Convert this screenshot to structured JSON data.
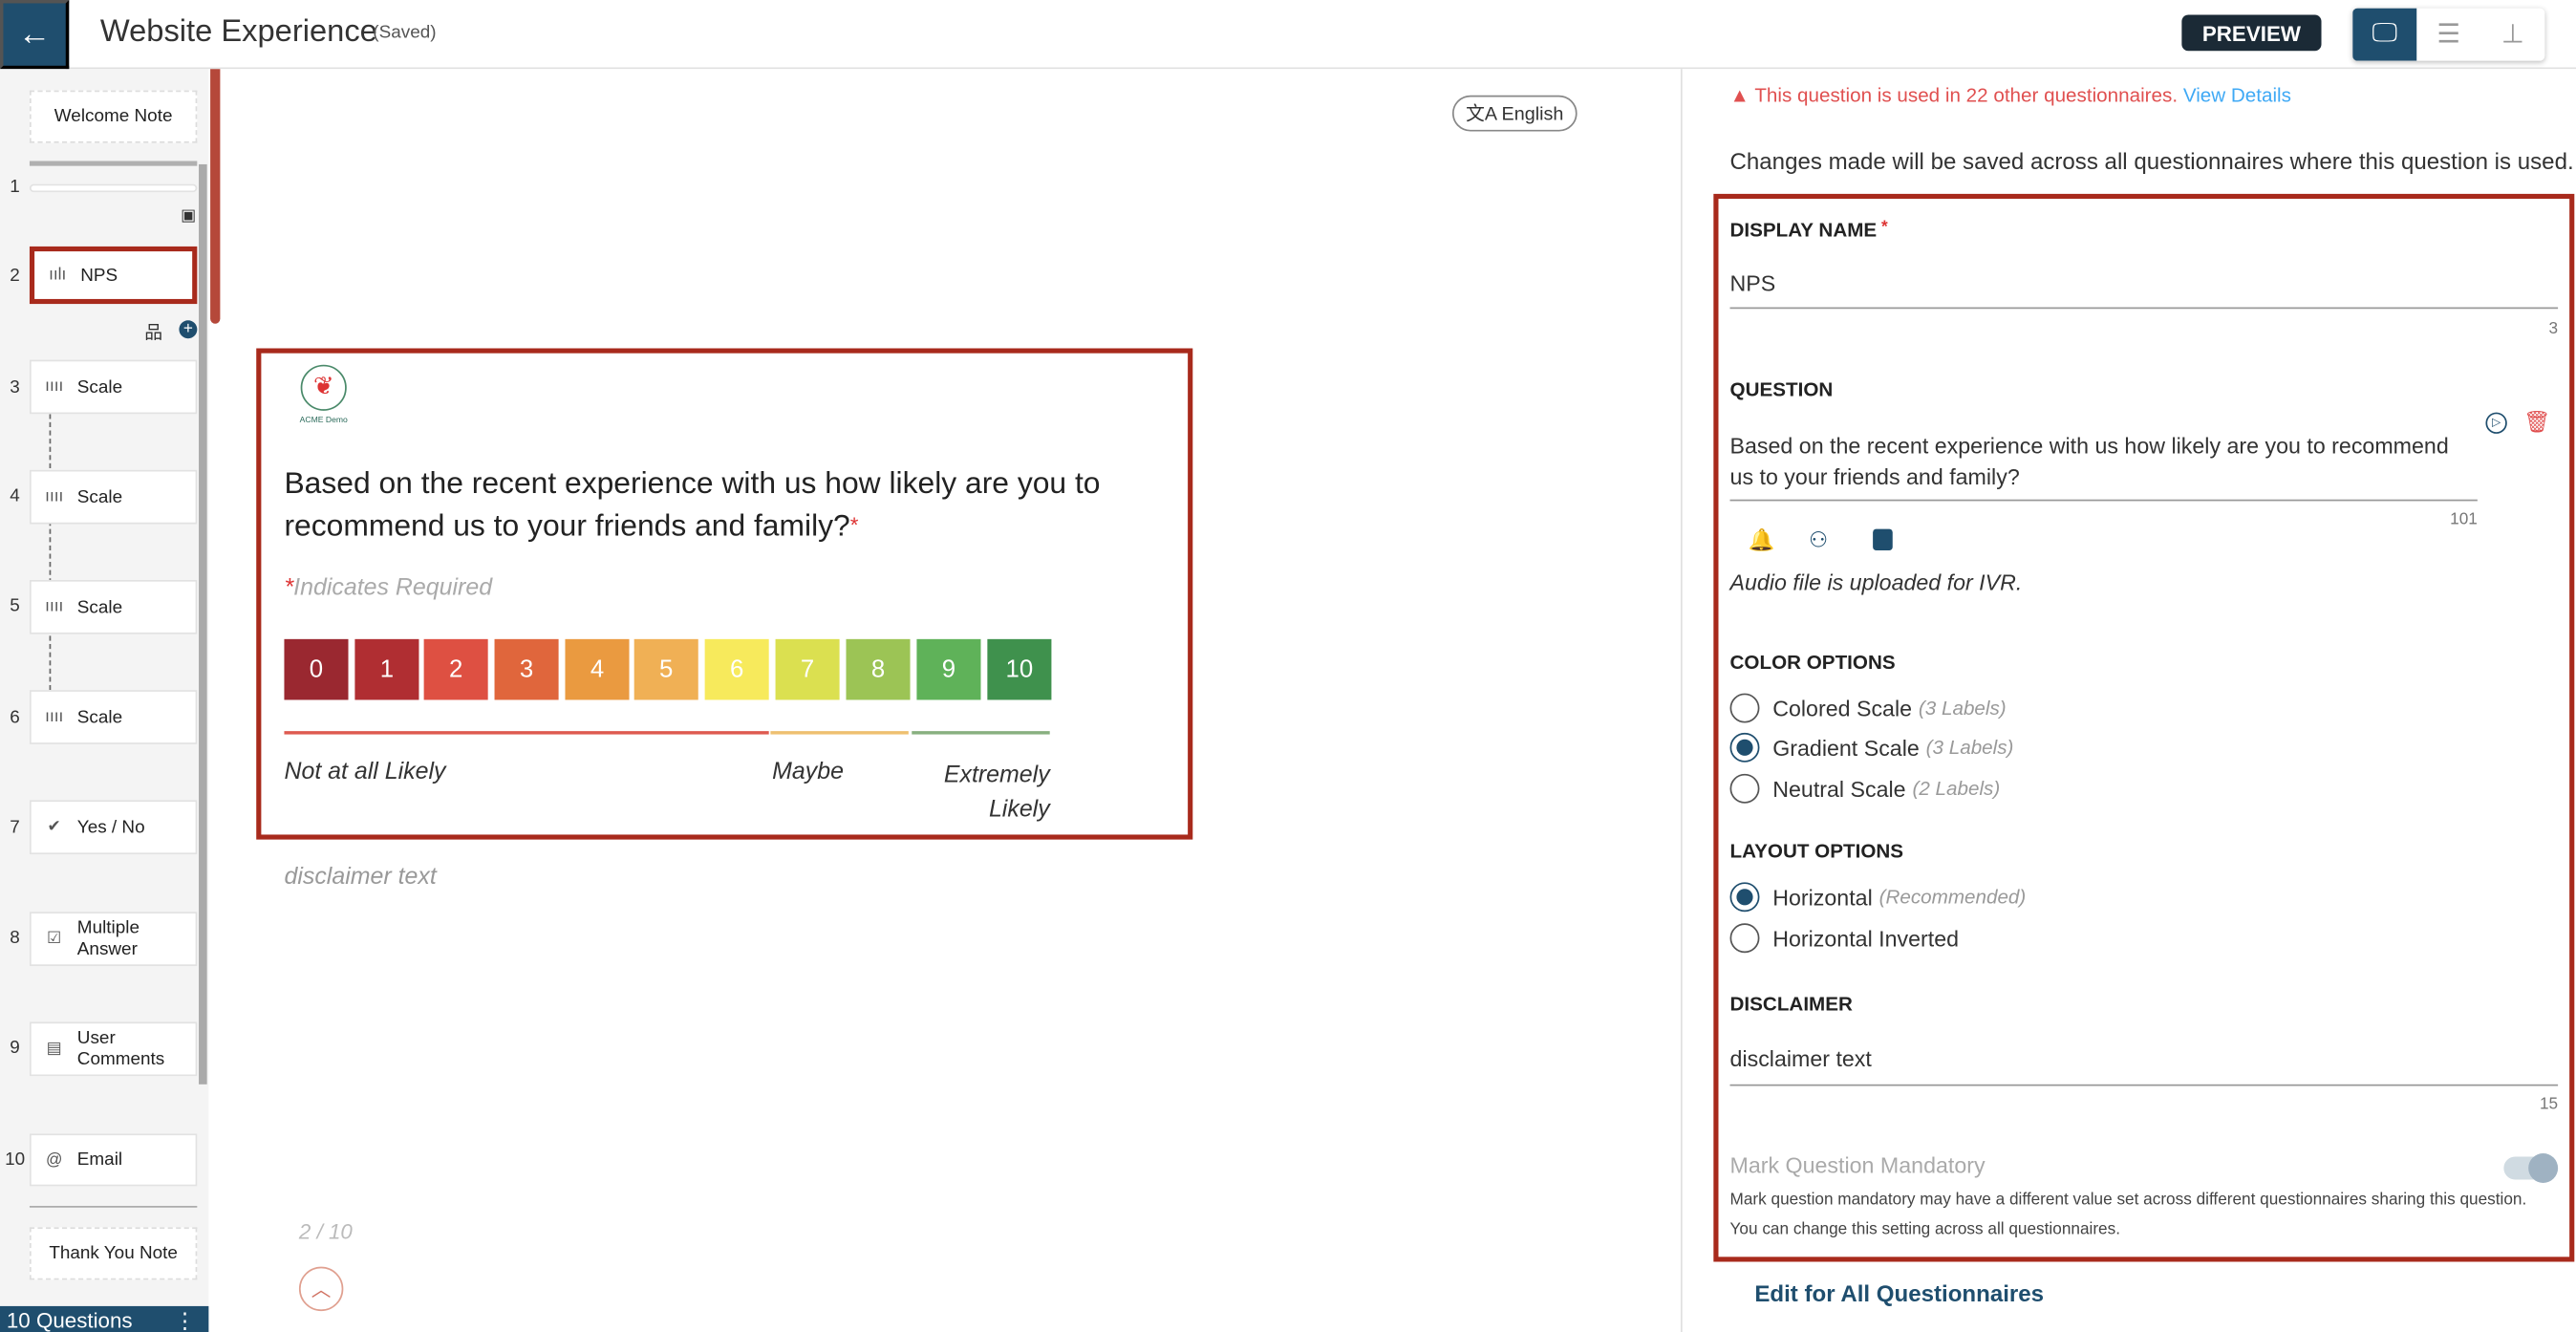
{
  "header": {
    "title": "Website Experience",
    "status": "(Saved)",
    "preview_label": "PREVIEW",
    "view_modes": [
      "desktop-icon",
      "list-icon",
      "hierarchy-icon"
    ],
    "active_view": "desktop"
  },
  "sidebar": {
    "welcome_note": "Welcome Note",
    "items": [
      {
        "num": "1",
        "label": "",
        "icon": "page-icon"
      },
      {
        "num": "2",
        "label": "NPS",
        "icon": "nps-icon",
        "selected": true
      },
      {
        "num": "3",
        "label": "Scale",
        "icon": "scale-icon"
      },
      {
        "num": "4",
        "label": "Scale",
        "icon": "scale-icon"
      },
      {
        "num": "5",
        "label": "Scale",
        "icon": "scale-icon"
      },
      {
        "num": "6",
        "label": "Scale",
        "icon": "scale-icon"
      },
      {
        "num": "7",
        "label": "Yes / No",
        "icon": "check-badge-icon"
      },
      {
        "num": "8",
        "label": "Multiple Answer",
        "icon": "checklist-icon"
      },
      {
        "num": "9",
        "label": "User Comments",
        "icon": "comment-icon"
      },
      {
        "num": "10",
        "label": "Email",
        "icon": "at-icon"
      }
    ],
    "thank_you_note": "Thank You Note",
    "footer": "10 Questions"
  },
  "preview": {
    "language": "English",
    "logo_text": "ACME Demo",
    "question": "Based on the recent experience with us how likely are you to recommend us to your friends and family?",
    "required_note": "Indicates Required",
    "scale": [
      {
        "v": "0",
        "c": "#9a2830"
      },
      {
        "v": "1",
        "c": "#b02e32"
      },
      {
        "v": "2",
        "c": "#de5042"
      },
      {
        "v": "3",
        "c": "#e0663c"
      },
      {
        "v": "4",
        "c": "#ea9a40"
      },
      {
        "v": "5",
        "c": "#f0b055"
      },
      {
        "v": "6",
        "c": "#f7ea5c"
      },
      {
        "v": "7",
        "c": "#dbe050"
      },
      {
        "v": "8",
        "c": "#9cc455"
      },
      {
        "v": "9",
        "c": "#5fb259"
      },
      {
        "v": "10",
        "c": "#3f914d"
      }
    ],
    "labels": {
      "low": "Not at all Likely",
      "mid": "Maybe",
      "high": "Extremely Likely"
    },
    "disclaimer": "disclaimer text",
    "pager": "2 / 10"
  },
  "panel": {
    "warning": "This question is used in 22 other questionnaires.",
    "view_details": "View Details",
    "info": "Changes made will be saved across all questionnaires where this question is used.",
    "display_name_label": "DISPLAY NAME",
    "display_name": "NPS",
    "display_name_count": "3",
    "question_label": "QUESTION",
    "question": "Based on the recent experience with us how likely are you to recommend us to your friends and family?",
    "question_count": "101",
    "audio_note": "Audio file is uploaded for IVR.",
    "color_label": "COLOR OPTIONS",
    "color_options": [
      {
        "label": "Colored Scale",
        "hint": "(3 Labels)",
        "selected": false
      },
      {
        "label": "Gradient Scale",
        "hint": "(3 Labels)",
        "selected": true
      },
      {
        "label": "Neutral Scale",
        "hint": "(2 Labels)",
        "selected": false
      }
    ],
    "layout_label": "LAYOUT OPTIONS",
    "layout_options": [
      {
        "label": "Horizontal",
        "hint": "(Recommended)",
        "selected": true
      },
      {
        "label": "Horizontal Inverted",
        "hint": "",
        "selected": false
      }
    ],
    "disclaimer_label": "DISCLAIMER",
    "disclaimer": "disclaimer text",
    "disclaimer_count": "15",
    "mandatory_label": "Mark Question Mandatory",
    "mandatory_on": true,
    "mandatory_note1": "Mark question mandatory may have a different value set across different questionnaires sharing this question.",
    "mandatory_note2": "You can change this setting across all questionnaires.",
    "edit_all": "Edit for All Questionnaires"
  },
  "colors": {
    "brand": "#1f4e6e",
    "highlight": "#a82a1c",
    "warning": "#e05050",
    "link": "#3fa9f5"
  }
}
